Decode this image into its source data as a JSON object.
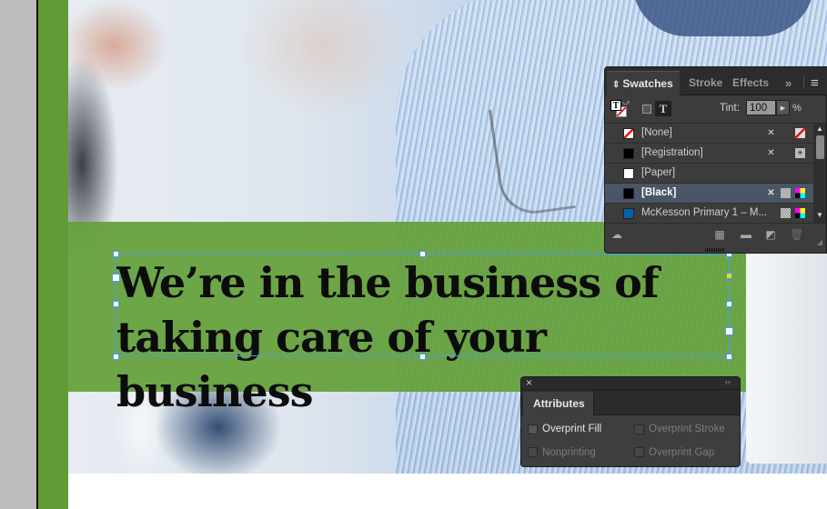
{
  "document": {
    "headline_line1": "We’re in the business of",
    "headline_line2": "taking care of your business",
    "colors": {
      "brand_green": "#609b36",
      "band_green": "#64a03a",
      "frame_blue": "#4a9bea",
      "selection_row": "#4a5566"
    }
  },
  "swatches_panel": {
    "tabs": [
      {
        "label": "Swatches",
        "active": true
      },
      {
        "label": "Stroke",
        "active": false
      },
      {
        "label": "Effects",
        "active": false
      }
    ],
    "overflow_icon": "double-chevron-right-icon",
    "menu_icon": "panel-menu-icon",
    "tint_label": "Tint:",
    "tint_value": "100",
    "tint_unit": "%",
    "swatches": [
      {
        "name": "[None]",
        "color": "none",
        "selected": false
      },
      {
        "name": "[Registration]",
        "color": "#000000",
        "selected": false
      },
      {
        "name": "[Paper]",
        "color": "#ffffff",
        "selected": false
      },
      {
        "name": "[Black]",
        "color": "#000000",
        "selected": true
      },
      {
        "name": "McKesson Primary 1 – M...",
        "color": "#0063a8",
        "selected": false
      }
    ]
  },
  "attributes_panel": {
    "close_glyph": "×",
    "collapse_glyph": "‹‹",
    "tab_label": "Attributes",
    "options": [
      {
        "label": "Overprint Fill",
        "checked": false,
        "enabled": true
      },
      {
        "label": "Overprint Stroke",
        "checked": false,
        "enabled": false
      },
      {
        "label": "Nonprinting",
        "checked": false,
        "enabled": false
      },
      {
        "label": "Overprint Gap",
        "checked": false,
        "enabled": false
      }
    ]
  },
  "icons": {
    "collapse_arrows": "⇕",
    "overflow": "»",
    "menu": "≡",
    "scroll_up": "▲",
    "scroll_down": "▼",
    "tint_arrow": "▶",
    "text_T": "T"
  }
}
